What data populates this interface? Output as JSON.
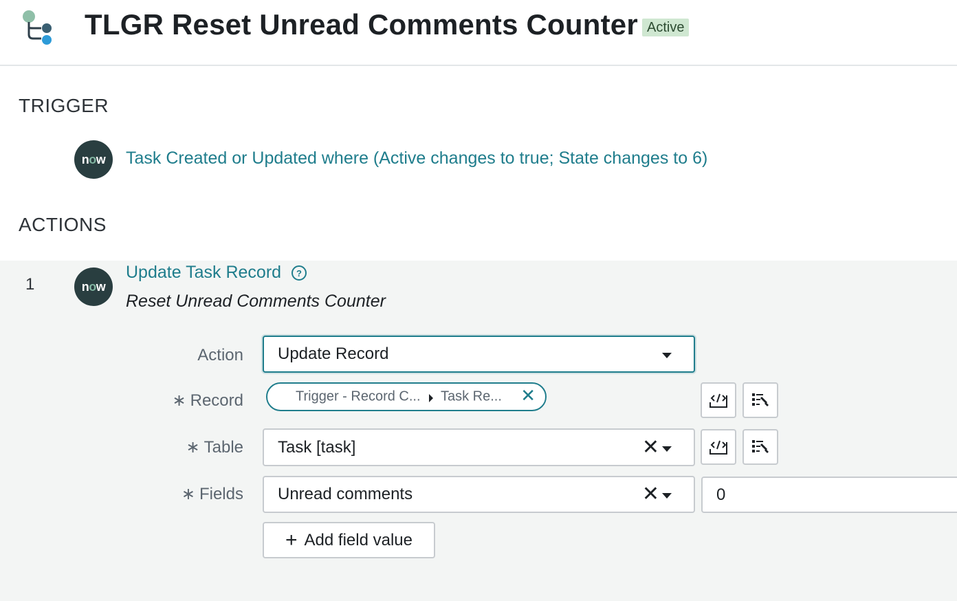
{
  "header": {
    "title": "TLGR Reset Unread Comments Counter",
    "status": "Active",
    "logo_icon": "flow-designer-icon"
  },
  "trigger": {
    "section_label": "TRIGGER",
    "badge_text_pre": "n",
    "badge_text_o": "o",
    "badge_text_post": "w",
    "description": "Task Created or Updated where (Active changes to true; State changes to 6)"
  },
  "actions": {
    "section_label": "ACTIONS",
    "items": [
      {
        "number": "1",
        "title": "Update Task Record",
        "help_icon": "help-icon",
        "subtitle": "Reset Unread Comments Counter",
        "fields": {
          "action": {
            "label": "Action",
            "value": "Update Record"
          },
          "record": {
            "label": "Record",
            "pill_segment_1": "Trigger - Record C...",
            "pill_segment_2": "Task Re..."
          },
          "table": {
            "label": "Table",
            "value": "Task [task]"
          },
          "fields": {
            "label": "Fields",
            "field_name": "Unread comments",
            "field_value": "0"
          }
        },
        "add_field_label": "Add field value"
      }
    ]
  },
  "icons": {
    "required": "asterisk-icon",
    "script": "script-icon",
    "data_picker": "data-pill-picker-icon",
    "clear": "clear-x-icon",
    "dropdown": "chevron-down-icon"
  },
  "colors": {
    "accent": "#1f7d8c",
    "now_badge": "#293e40",
    "active_badge_bg": "#cfe7d1",
    "panel_bg": "#f3f5f4"
  }
}
